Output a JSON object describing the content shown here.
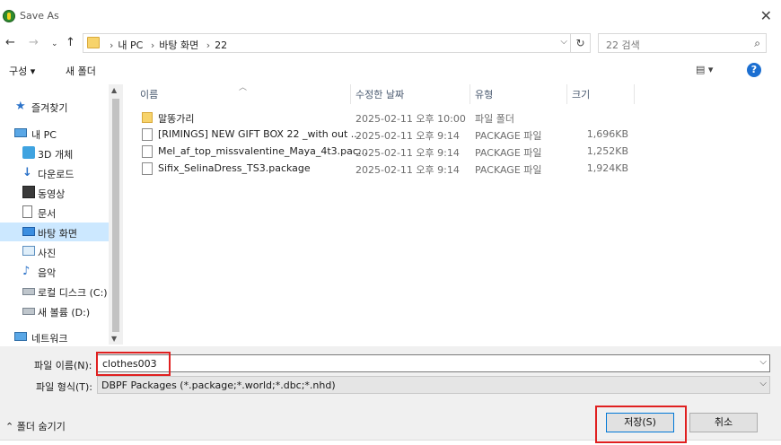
{
  "window": {
    "title": "Save As",
    "close_icon": "close-icon"
  },
  "nav": {
    "breadcrumbs": [
      "내 PC",
      "바탕 화면",
      "22"
    ],
    "search_placeholder": "22 검색"
  },
  "toolbar": {
    "organize_label": "구성 ▾",
    "new_folder_label": "새 폴더",
    "view_label": "▾",
    "help_label": "?"
  },
  "sidebar": {
    "items": [
      {
        "label": "즐겨찾기",
        "icon": "star-icon"
      },
      {
        "label": "내 PC",
        "icon": "computer-icon"
      },
      {
        "label": "3D 개체",
        "icon": "cube-icon"
      },
      {
        "label": "다운로드",
        "icon": "download-icon"
      },
      {
        "label": "동영상",
        "icon": "video-icon"
      },
      {
        "label": "문서",
        "icon": "document-icon"
      },
      {
        "label": "바탕 화면",
        "icon": "desktop-icon",
        "selected": true
      },
      {
        "label": "사진",
        "icon": "pictures-icon"
      },
      {
        "label": "음악",
        "icon": "music-icon"
      },
      {
        "label": "로컬 디스크 (C:)",
        "icon": "drive-icon"
      },
      {
        "label": "새 볼륨 (D:)",
        "icon": "drive-icon"
      },
      {
        "label": "네트워크",
        "icon": "network-icon"
      }
    ]
  },
  "files": {
    "columns": {
      "name": "이름",
      "date": "수정한 날짜",
      "type": "유형",
      "size": "크기"
    },
    "rows": [
      {
        "name": "말똥가리",
        "date": "2025-02-11 오후 10:00",
        "type": "파일 폴더",
        "size": "",
        "kind": "folder"
      },
      {
        "name": "[RIMINGS] NEW GIFT BOX 22 _with out ...",
        "date": "2025-02-11 오후 9:14",
        "type": "PACKAGE 파일",
        "size": "1,696KB",
        "kind": "file"
      },
      {
        "name": "Mel_af_top_missvalentine_Maya_4t3.pac...",
        "date": "2025-02-11 오후 9:14",
        "type": "PACKAGE 파일",
        "size": "1,252KB",
        "kind": "file"
      },
      {
        "name": "Sifix_SelinaDress_TS3.package",
        "date": "2025-02-11 오후 9:14",
        "type": "PACKAGE 파일",
        "size": "1,924KB",
        "kind": "file"
      }
    ]
  },
  "form": {
    "filename_label": "파일 이름(N):",
    "filename_value": "clothes003",
    "filetype_label": "파일 형식(T):",
    "filetype_value": "DBPF Packages (*.package;*.world;*.dbc;*.nhd)"
  },
  "footer": {
    "hide_folders_label": "폴더 숨기기",
    "save_label": "저장(S)",
    "cancel_label": "취소"
  },
  "colors": {
    "accent": "#0078d7",
    "highlight": "#e02020",
    "selected": "#cce8ff"
  }
}
